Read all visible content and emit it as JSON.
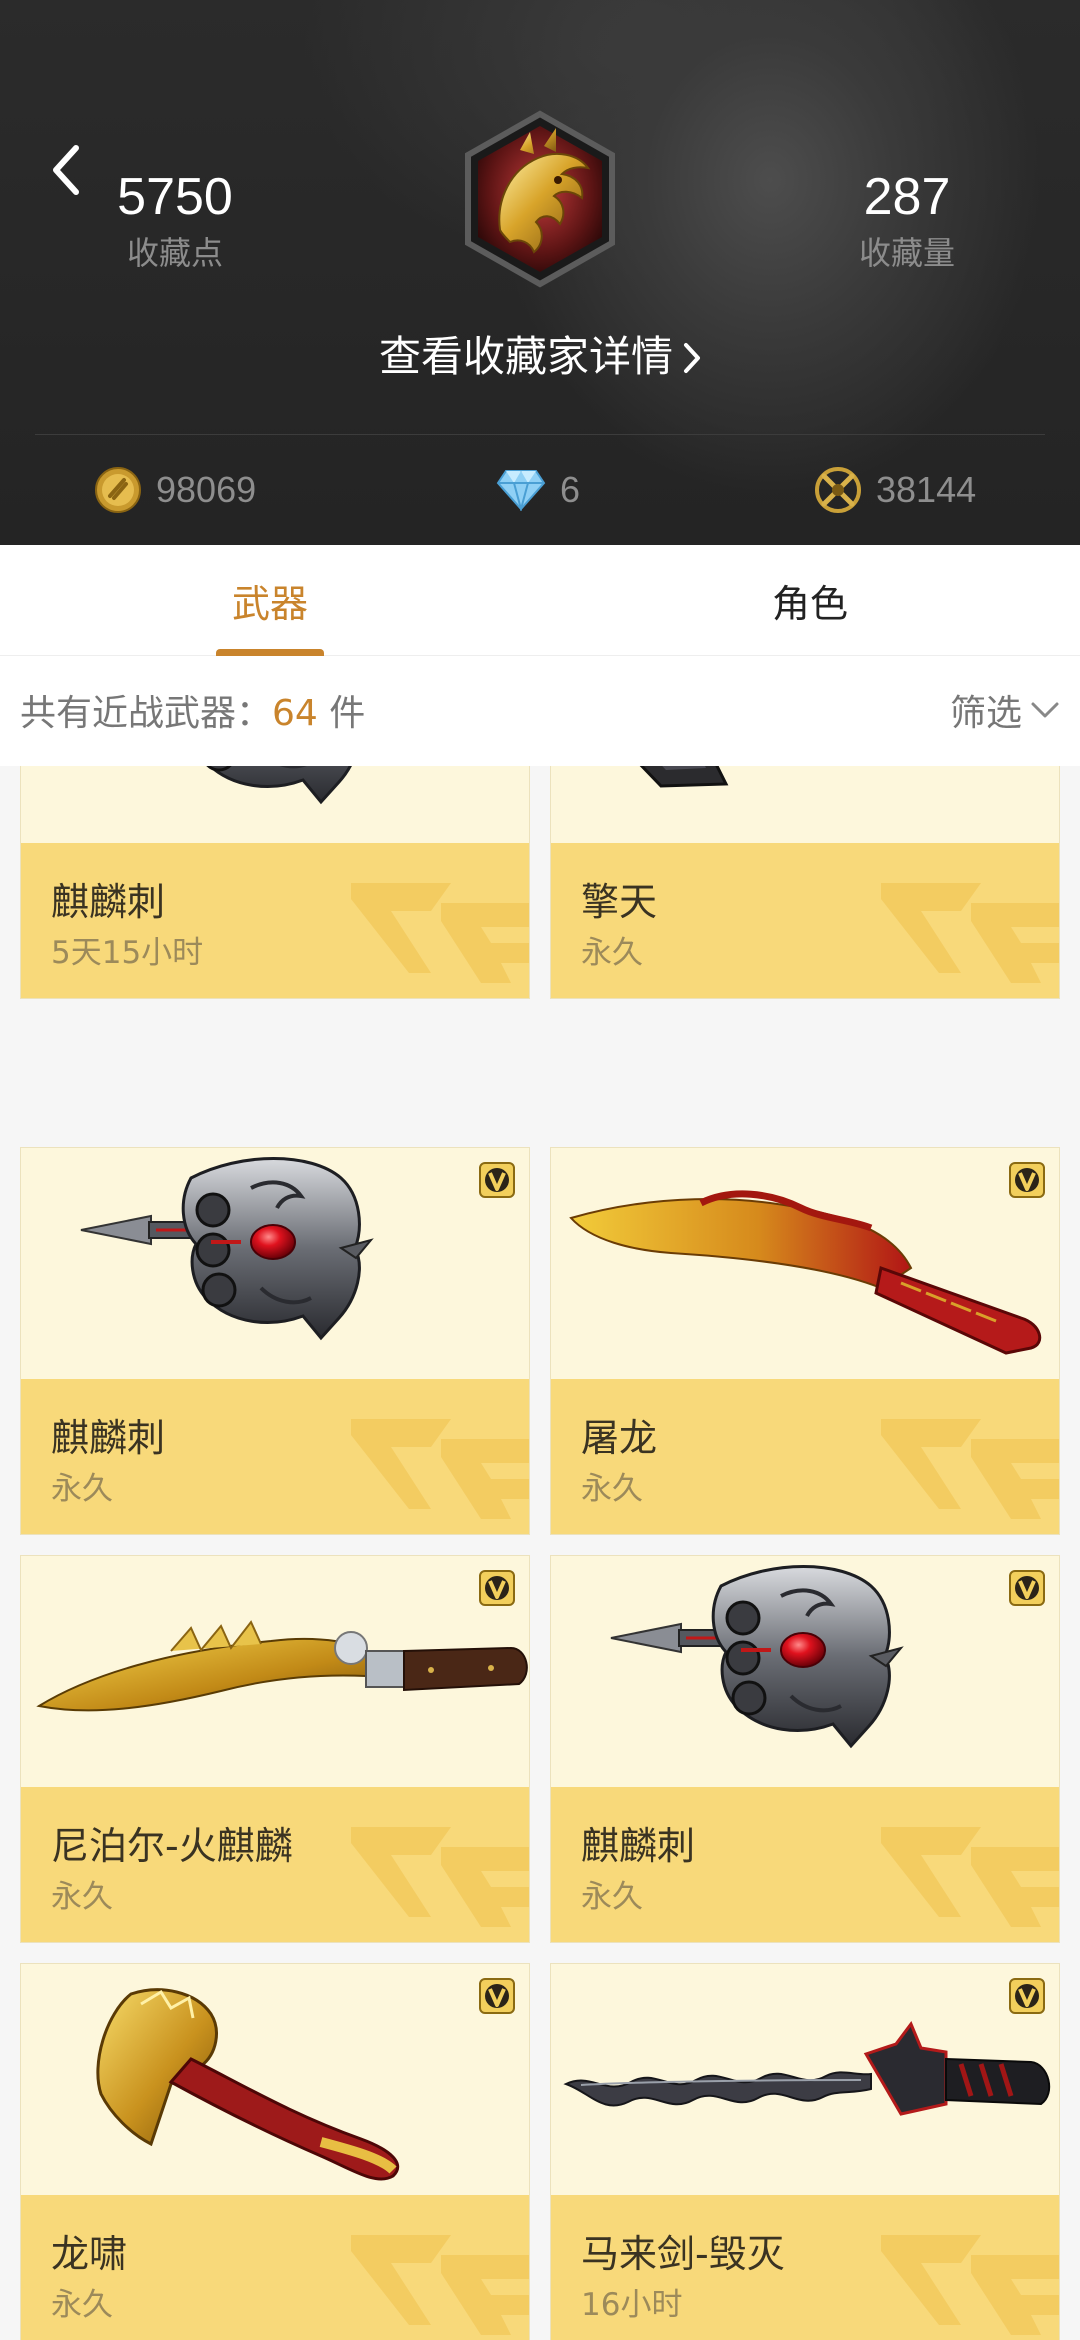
{
  "header": {
    "collection_points": "5750",
    "collection_points_label": "收藏点",
    "collection_count": "287",
    "collection_count_label": "收藏量",
    "details_link": "查看收藏家详情",
    "currencies": [
      {
        "icon": "gold-coin-icon",
        "value": "98069"
      },
      {
        "icon": "diamond-icon",
        "value": "6"
      },
      {
        "icon": "crossed-swords-icon",
        "value": "38144"
      }
    ]
  },
  "tabs": [
    {
      "label": "武器",
      "active": true
    },
    {
      "label": "角色",
      "active": false
    }
  ],
  "count_bar": {
    "prefix": "共有近战武器：",
    "count": "64",
    "suffix": " 件",
    "filter_label": "筛选"
  },
  "items": [
    {
      "name": "麒麟刺",
      "duration": "5天15小时",
      "weapon": "knuckle-blade",
      "vip": true
    },
    {
      "name": "擎天",
      "duration": "永久",
      "weapon": "shovel",
      "vip": true
    },
    {
      "name": "麒麟刺",
      "duration": "永久",
      "weapon": "knuckle-blade",
      "vip": true
    },
    {
      "name": "屠龙",
      "duration": "永久",
      "weapon": "dragon-machete",
      "vip": true
    },
    {
      "name": "尼泊尔-火麒麟",
      "duration": "永久",
      "weapon": "gold-kukri",
      "vip": true
    },
    {
      "name": "麒麟刺",
      "duration": "永久",
      "weapon": "knuckle-blade",
      "vip": true
    },
    {
      "name": "龙啸",
      "duration": "永久",
      "weapon": "dragon-axe",
      "vip": true
    },
    {
      "name": "马来剑-毁灭",
      "duration": "16小时",
      "weapon": "kris-sword",
      "vip": true
    }
  ],
  "colors": {
    "accent": "#c9842c",
    "card_bg": "#fdf7dc",
    "card_info_bg": "#f8d97a",
    "header_bg": "#262626"
  }
}
